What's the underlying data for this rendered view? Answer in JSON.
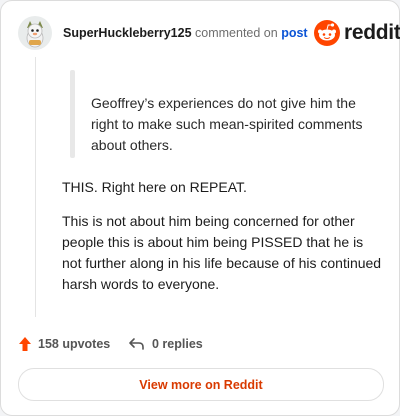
{
  "comment": {
    "author": "SuperHuckleberry125",
    "verb": "commented on",
    "target_link": "post",
    "quote": "Geoffrey’s experiences do not give him the right to make such mean-spirited comments about others.",
    "paragraphs": [
      "THIS. Right here on REPEAT.",
      "This is not about him being concerned for other people this is about him being PISSED that he is not further along in his life because of his continued harsh words to everyone."
    ]
  },
  "brand": {
    "wordmark": "reddit",
    "accent": "#ff4500"
  },
  "actions": {
    "upvotes": "158 upvotes",
    "replies": "0 replies",
    "upvote_icon": "upvote-arrow-icon",
    "reply_icon": "reply-arrow-icon"
  },
  "view_more_label": "View more on Reddit",
  "colors": {
    "link": "#0b54d6",
    "accent": "#ff4500",
    "button_text": "#d93a00"
  }
}
